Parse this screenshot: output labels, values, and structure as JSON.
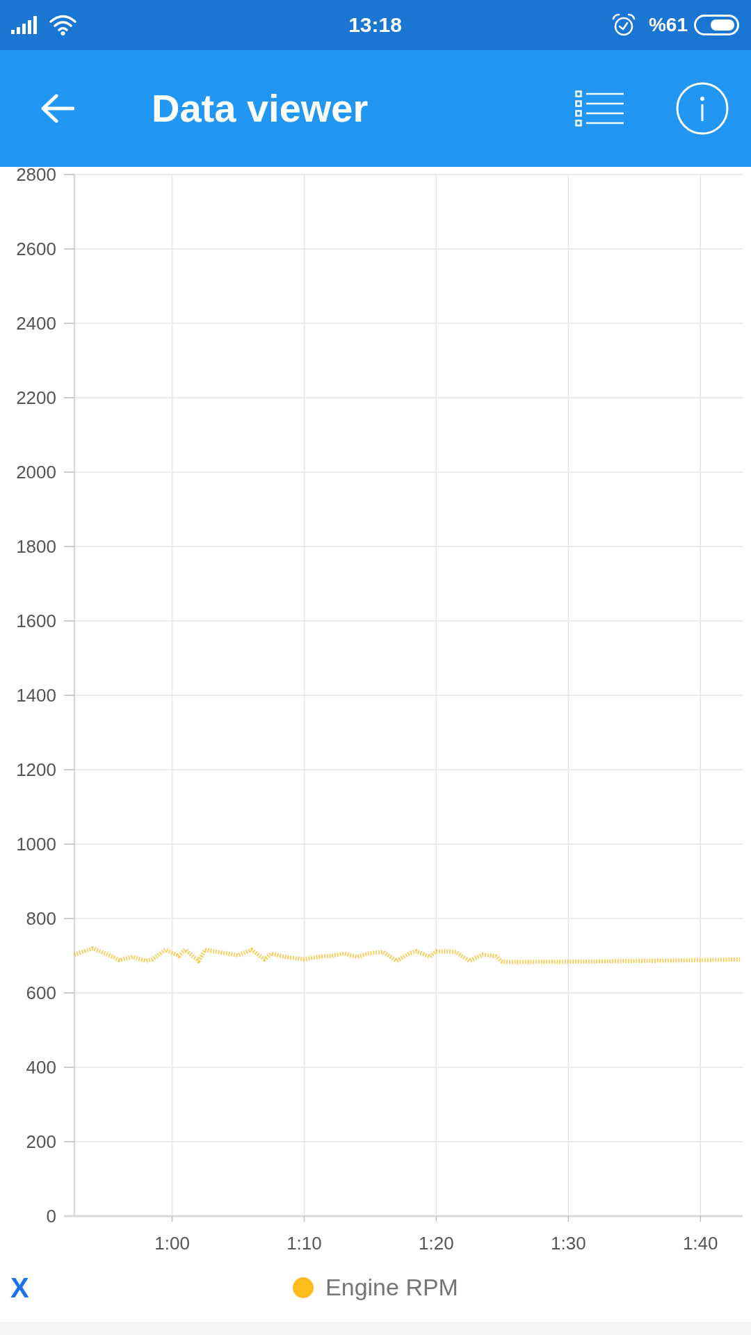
{
  "status_bar": {
    "time": "13:18",
    "battery": "%61"
  },
  "app_bar": {
    "title": "Data viewer"
  },
  "chart": {
    "chart_data": {
      "type": "line",
      "grid": true,
      "x": [
        52.6,
        54,
        55.5,
        56,
        57,
        58,
        58.5,
        59.5,
        60.5,
        61,
        62,
        62.5,
        64,
        65,
        66,
        67,
        67.5,
        68.5,
        70,
        71,
        72,
        73,
        74,
        75,
        76,
        77,
        78,
        78.5,
        79.5,
        80,
        81.5,
        82.5,
        83.5,
        84.5,
        85,
        85.5,
        90,
        95,
        100,
        103
      ],
      "series": [
        {
          "name": "Engine RPM",
          "color": "#fbbc1c",
          "line_style": "dashed",
          "values": [
            703,
            720,
            697,
            688,
            697,
            686,
            690,
            716,
            699,
            716,
            686,
            716,
            707,
            701,
            716,
            690,
            706,
            697,
            690,
            697,
            699,
            706,
            697,
            707,
            710,
            686,
            707,
            712,
            697,
            712,
            710,
            686,
            703,
            699,
            684,
            683,
            684,
            686,
            688,
            690
          ]
        }
      ],
      "xlim": [
        52.6,
        103.2
      ],
      "ylim": [
        0,
        2800
      ],
      "xticks": [
        {
          "value": 60,
          "label": "1:00"
        },
        {
          "value": 70,
          "label": "1:10"
        },
        {
          "value": 80,
          "label": "1:20"
        },
        {
          "value": 90,
          "label": "1:30"
        },
        {
          "value": 100,
          "label": "1:40"
        }
      ],
      "yticks": [
        0,
        200,
        400,
        600,
        800,
        1000,
        1200,
        1400,
        1600,
        1800,
        2000,
        2200,
        2400,
        2600,
        2800
      ]
    }
  },
  "x_button": {
    "label": "X"
  }
}
